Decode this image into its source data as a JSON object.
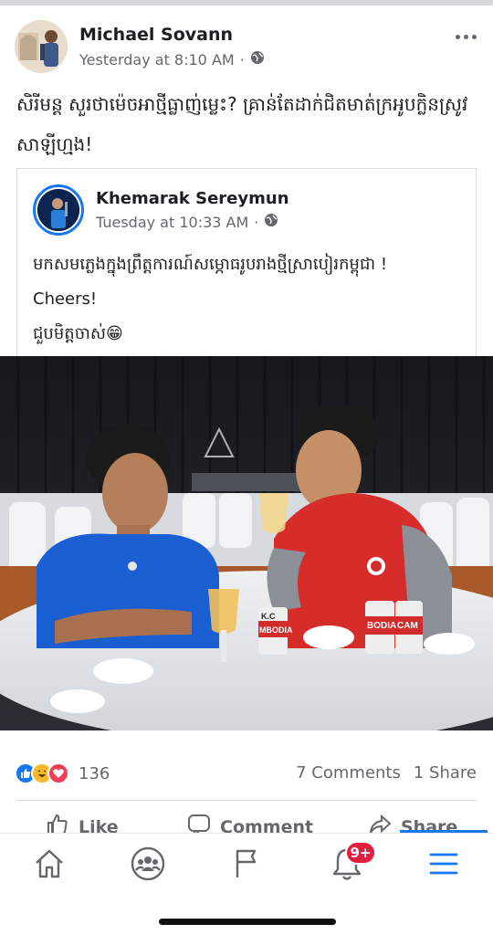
{
  "post": {
    "author": "Michael Sovann",
    "time": "Yesterday at 8:10 AM",
    "separator": "·",
    "text_line1": "សិរីមន្ត សួរថាម៉េចអាថ្មីធ្លាញ់ម្លេះ? គ្រាន់តែដាក់ជិតមាត់ក្រអូបក្លិនស្រូវ",
    "text_line2": "សាឡីហ្មង!"
  },
  "shared_post": {
    "author": "Khemarak Sereymun",
    "time": "Tuesday at 10:33 AM",
    "separator": "·",
    "line1": "មកសមភ្លេងក្នុងព្រឹត្តការណ៍សម្ភោធរូបរាងថ្មីស្រាបៀរកម្ពុជា !",
    "line2": "Cheers!",
    "line3": "ជួបមិត្តចាស់😁"
  },
  "photo": {
    "can_label_1": "K.C",
    "can_label_2": "MBODIA",
    "can_label_3": "BODIA",
    "can_label_4": "CAM"
  },
  "reactions": {
    "icons": [
      "like-reaction",
      "haha-reaction",
      "love-reaction"
    ],
    "count": "136",
    "comments": "7 Comments",
    "shares": "1 Share"
  },
  "actions": {
    "like": "Like",
    "comment": "Comment",
    "share": "Share"
  },
  "tabbar": {
    "icons": [
      "home-icon",
      "groups-icon",
      "pages-flag-icon",
      "notifications-bell-icon",
      "menu-icon"
    ],
    "notification_badge": "9+",
    "active_color": "#1877f2"
  },
  "colors": {
    "brand_blue": "#1877f2",
    "badge_red": "#e41e3f",
    "secondary_text": "#65676b"
  }
}
